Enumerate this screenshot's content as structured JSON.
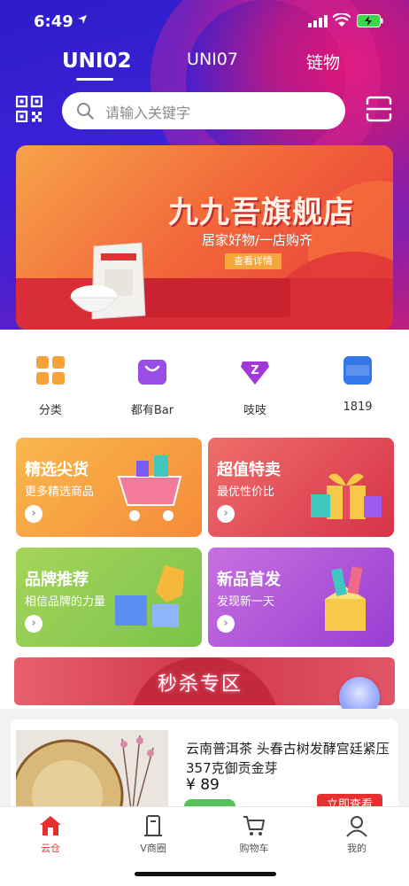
{
  "status_bar": {
    "time": "6:49"
  },
  "top_tabs": [
    {
      "label": "UNI02",
      "active": true
    },
    {
      "label": "UNI07",
      "active": false
    },
    {
      "label": "链物",
      "active": false
    }
  ],
  "search": {
    "placeholder": "请输入关键字"
  },
  "banner": {
    "title": "九九吾旗舰店",
    "subtitle": "居家好物/一店购齐",
    "button": "查看详情"
  },
  "quick_entries": [
    {
      "label": "分类",
      "icon": "grid-icon"
    },
    {
      "label": "都有Bar",
      "icon": "shopping-bag-icon"
    },
    {
      "label": "吱吱",
      "icon": "z-gem-icon"
    },
    {
      "label": "1819",
      "icon": "1819-logo-icon"
    }
  ],
  "promos": [
    {
      "title": "精选尖货",
      "subtitle": "更多精选商品",
      "color_start": "#f9b54a",
      "color_end": "#f58a3c"
    },
    {
      "title": "超值特卖",
      "subtitle": "最优性价比",
      "color_start": "#ef6b6b",
      "color_end": "#d8344a"
    },
    {
      "title": "品牌推荐",
      "subtitle": "相信品牌的力量",
      "color_start": "#a9d65a",
      "color_end": "#7cc24a"
    },
    {
      "title": "新品首发",
      "subtitle": "发现新一天",
      "color_start": "#c86ee0",
      "color_end": "#9a3fd0"
    }
  ],
  "flash_sale": {
    "title": "秒杀专区"
  },
  "product": {
    "name": "云南普洱茶 头春古树发酵宫廷紧压357克御贡金芽",
    "price": "¥ 89",
    "buy_label": "立即查看"
  },
  "bottom_nav": [
    {
      "label": "云仓",
      "icon": "home-icon",
      "active": true
    },
    {
      "label": "V商圈",
      "icon": "v-shop-icon",
      "active": false
    },
    {
      "label": "购物车",
      "icon": "cart-icon",
      "active": false
    },
    {
      "label": "我的",
      "icon": "profile-icon",
      "active": false
    }
  ],
  "colors": {
    "accent": "#e4312f",
    "hero_purple": "#3d22d6"
  }
}
